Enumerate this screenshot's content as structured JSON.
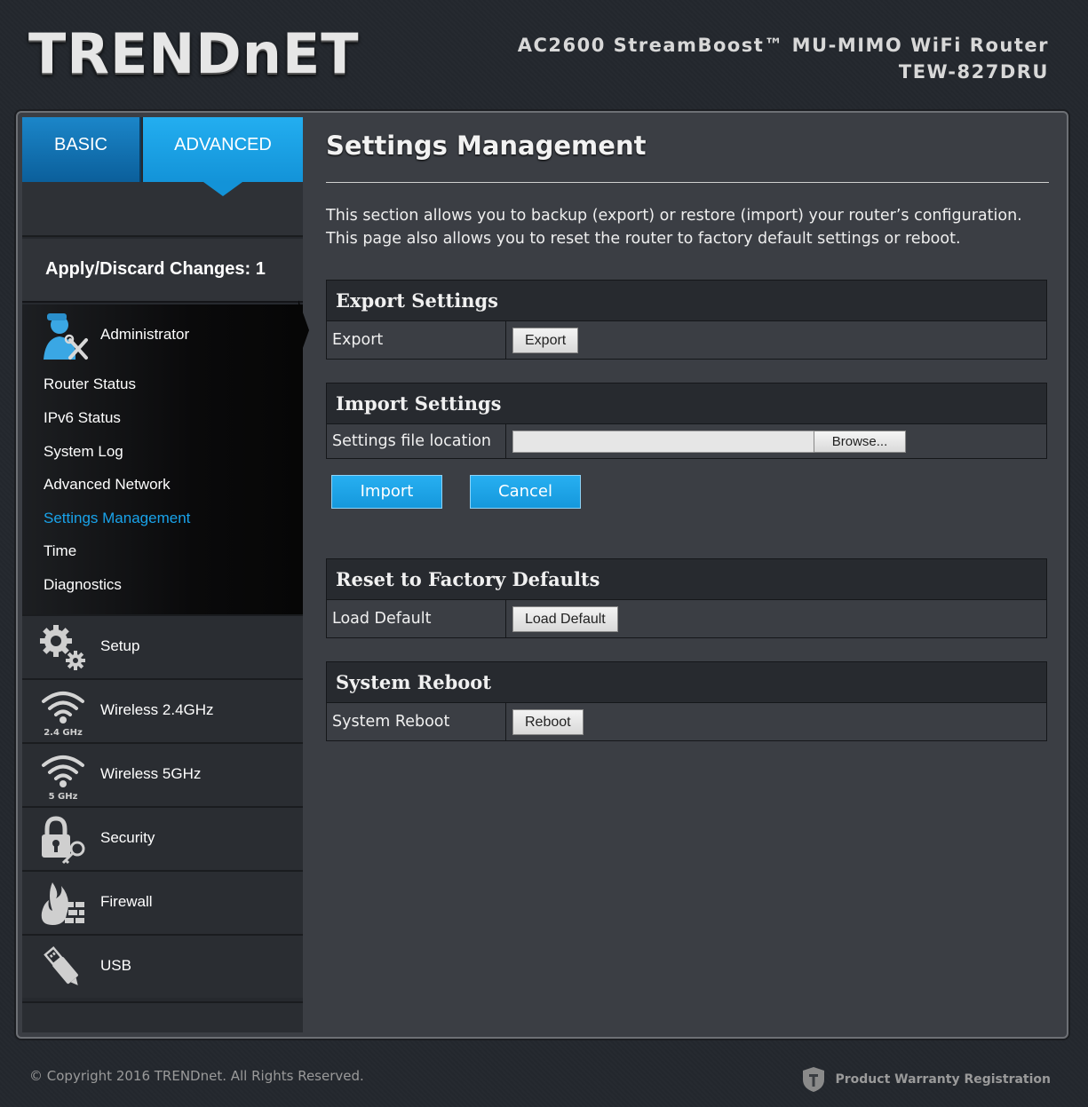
{
  "header": {
    "logo": "TRENDnET",
    "product_line1": "AC2600 StreamBoost™ MU-MIMO WiFi Router",
    "product_line2": "TEW-827DRU"
  },
  "tabs": {
    "basic": "BASIC",
    "advanced": "ADVANCED",
    "active": "advanced"
  },
  "apply": "Apply/Discard Changes: 1",
  "sidebar": {
    "admin_label": "Administrator",
    "admin_items": [
      {
        "label": "Router Status"
      },
      {
        "label": "IPv6 Status"
      },
      {
        "label": "System Log"
      },
      {
        "label": "Advanced Network"
      },
      {
        "label": "Settings Management",
        "active": true
      },
      {
        "label": "Time"
      },
      {
        "label": "Diagnostics"
      }
    ],
    "nav": [
      {
        "label": "Setup",
        "icon": "gears-icon"
      },
      {
        "label": "Wireless 2.4GHz",
        "icon": "wifi-2-4ghz-icon",
        "badge": "2.4 GHz"
      },
      {
        "label": "Wireless 5GHz",
        "icon": "wifi-5ghz-icon",
        "badge": "5 GHz"
      },
      {
        "label": "Security",
        "icon": "lock-key-icon"
      },
      {
        "label": "Firewall",
        "icon": "firewall-icon"
      },
      {
        "label": "USB",
        "icon": "usb-icon"
      }
    ]
  },
  "main": {
    "title": "Settings Management",
    "description_line1": "This section allows you to backup (export) or restore (import) your router’s configuration.",
    "description_line2": "This page also allows you to reset the router to factory default settings or reboot.",
    "export": {
      "heading": "Export Settings",
      "label": "Export",
      "button": "Export"
    },
    "import": {
      "heading": "Import Settings",
      "label": "Settings file location",
      "file_value": "",
      "browse": "Browse...",
      "import_button": "Import",
      "cancel_button": "Cancel"
    },
    "reset": {
      "heading": "Reset to Factory Defaults",
      "label": "Load Default",
      "button": "Load Default"
    },
    "reboot": {
      "heading": "System Reboot",
      "label": "System Reboot",
      "button": "Reboot"
    }
  },
  "footer": {
    "copyright": "© Copyright 2016 TRENDnet. All Rights Reserved.",
    "warranty": "Product Warranty Registration"
  },
  "colors": {
    "accent": "#19a3ea",
    "tab_active": "#1393d8",
    "background": "#23272d",
    "panel": "#3b3e44"
  }
}
